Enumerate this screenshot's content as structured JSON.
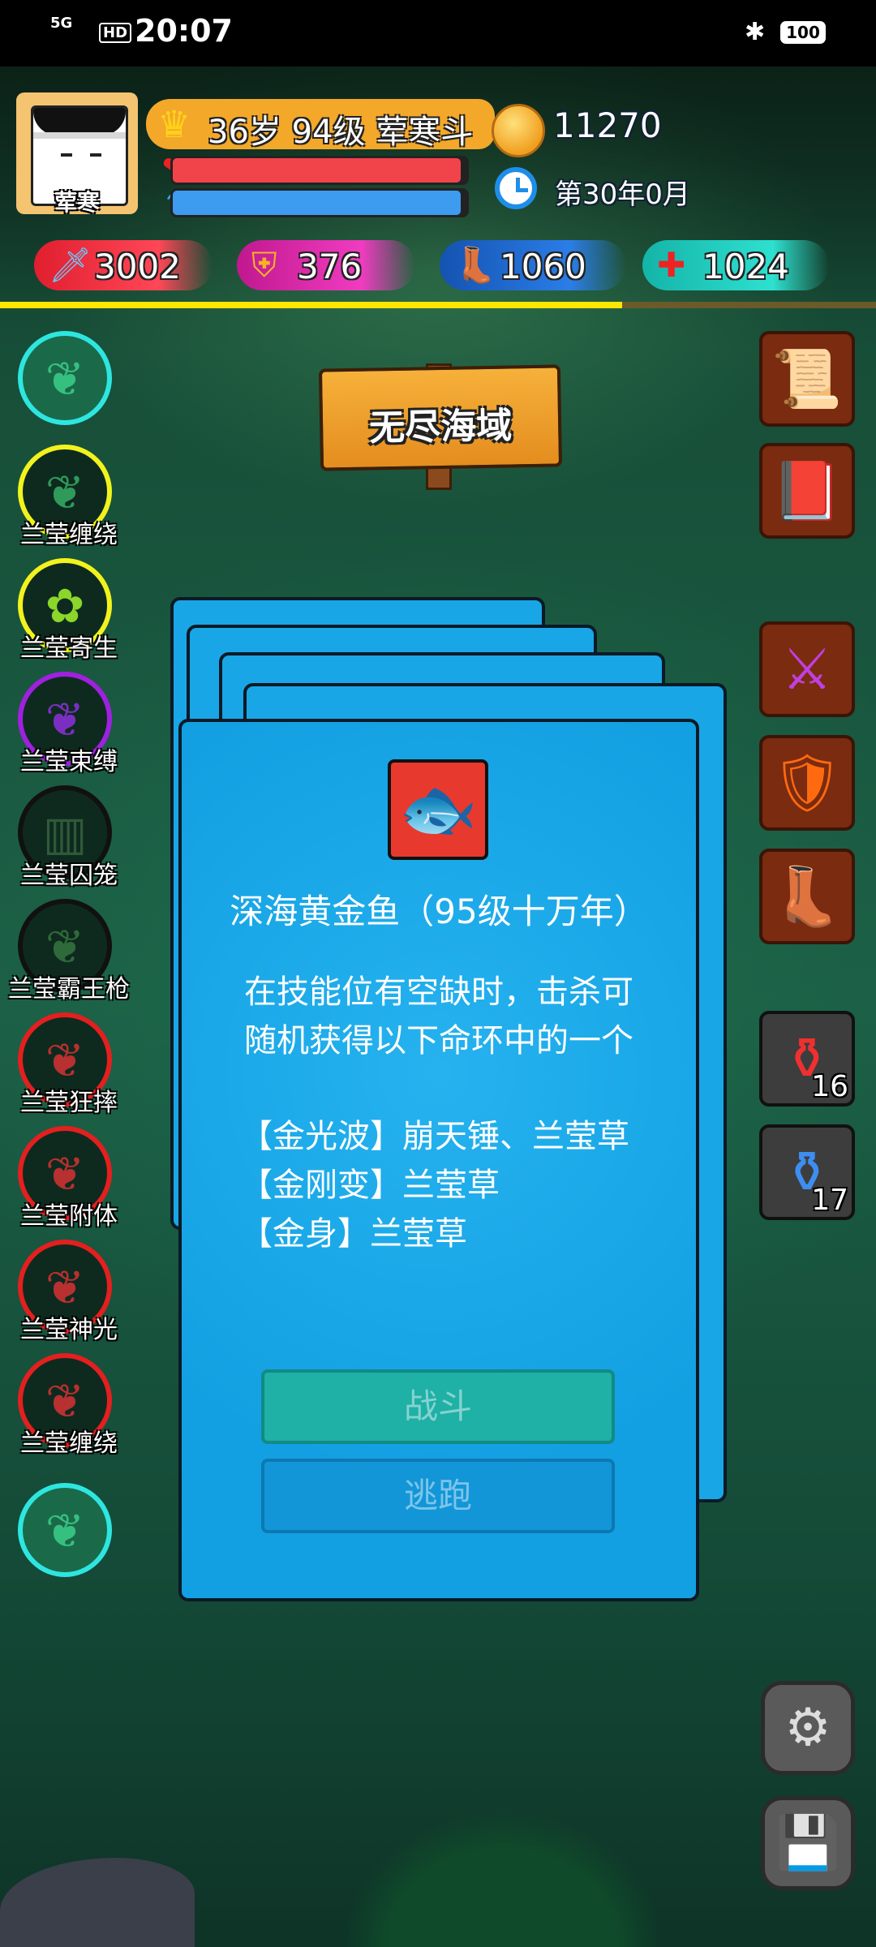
{
  "status_bar": {
    "network": "5G",
    "hd": "HD",
    "time": "20:07",
    "bluetooth_icon": "bluetooth-icon",
    "battery": "100"
  },
  "player": {
    "avatar_name": "荤寒",
    "level_text": "36岁 94级 荤寒斗",
    "coins": "11270",
    "date": "第30年0月",
    "hp_fraction": 0.98,
    "mp_fraction": 0.98,
    "exp_fraction": 0.71
  },
  "stats": {
    "attack": "3002",
    "defense": "376",
    "speed": "1060",
    "health": "1024"
  },
  "location": {
    "sign_text": "无尽海域"
  },
  "skills": [
    {
      "label": "",
      "ring_color": "#2ee6e0",
      "icon": "leaf-icon"
    },
    {
      "label": "兰莹缠绕",
      "ring_color": "#f2f21e",
      "icon": "vine-icon"
    },
    {
      "label": "兰莹寄生",
      "ring_color": "#f2f21e",
      "icon": "seed-icon"
    },
    {
      "label": "兰莹束缚",
      "ring_color": "#a020e0",
      "icon": "bind-icon"
    },
    {
      "label": "兰莹囚笼",
      "ring_color": "#111111",
      "icon": "cage-icon"
    },
    {
      "label": "兰莹霸王枪",
      "ring_color": "#111111",
      "icon": "spear-icon"
    },
    {
      "label": "兰莹狂摔",
      "ring_color": "#e41f1f",
      "icon": "slam-icon"
    },
    {
      "label": "兰莹附体",
      "ring_color": "#e41f1f",
      "icon": "possess-icon"
    },
    {
      "label": "兰莹神光",
      "ring_color": "#e41f1f",
      "icon": "light-icon"
    },
    {
      "label": "兰莹缠绕",
      "ring_color": "#e41f1f",
      "icon": "vine-icon"
    },
    {
      "label": "",
      "ring_color": "#2ee6e0",
      "icon": "leaf-hammer-icon"
    }
  ],
  "items": {
    "map_icon": "map-scroll-icon",
    "book_icon": "book-icon",
    "weapon_icon": "sword-icon",
    "armor_icon": "armor-icon",
    "boots_icon": "boots-icon",
    "red_potion_count": "16",
    "blue_potion_count": "17",
    "settings_icon": "gear-icon",
    "save_icon": "save-icon"
  },
  "encounter": {
    "monster_name": "深海黄金鱼（95级十万年）",
    "desc_line1": "在技能位有空缺时，击杀可",
    "desc_line2": "随机获得以下命环中的一个",
    "rings": [
      "【金光波】崩天锤、兰莹草",
      "【金刚变】兰莹草",
      "【金身】兰莹草"
    ],
    "fight_label": "战斗",
    "flee_label": "逃跑"
  },
  "colors": {
    "card_blue": "#19a6e6",
    "hp_red": "#f0444a",
    "mp_blue": "#3d9bf0",
    "exp_yellow": "#ffe600"
  }
}
